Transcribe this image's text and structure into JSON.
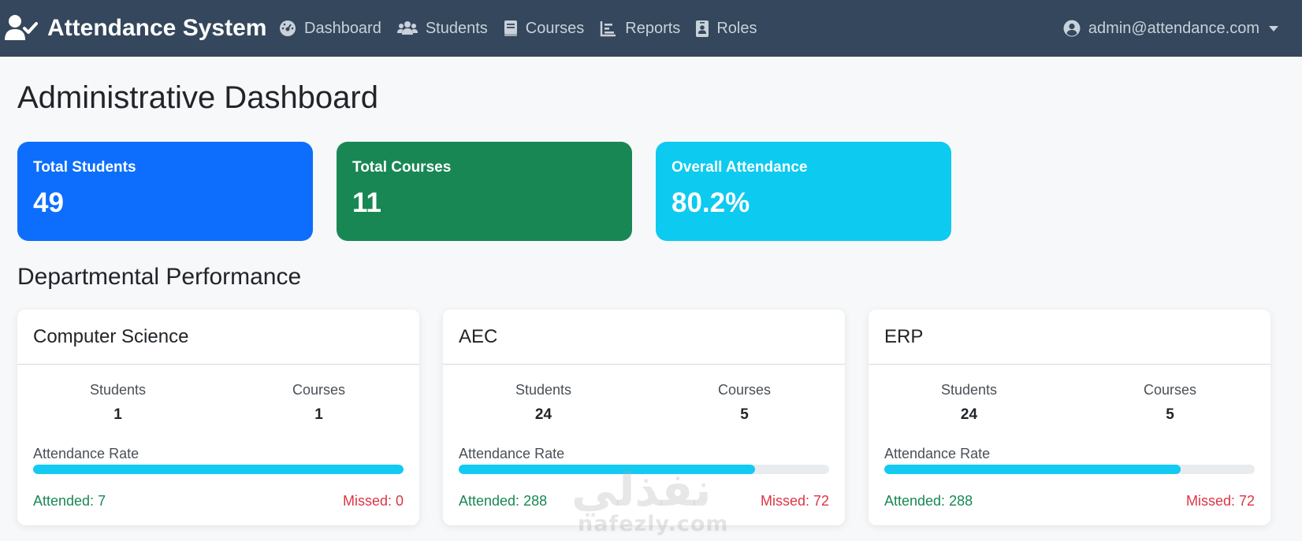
{
  "navbar": {
    "brand": "Attendance System",
    "links": [
      {
        "label": "Dashboard",
        "icon": "dashboard-icon"
      },
      {
        "label": "Students",
        "icon": "users-icon"
      },
      {
        "label": "Courses",
        "icon": "book-icon"
      },
      {
        "label": "Reports",
        "icon": "bar-chart-icon"
      },
      {
        "label": "Roles",
        "icon": "id-badge-icon"
      }
    ],
    "user": "admin@attendance.com"
  },
  "page_title": "Administrative Dashboard",
  "stats": [
    {
      "label": "Total Students",
      "value": "49",
      "color": "#0d6efd"
    },
    {
      "label": "Total Courses",
      "value": "11",
      "color": "#198754"
    },
    {
      "label": "Overall Attendance",
      "value": "80.2%",
      "color": "#0dcaf0"
    }
  ],
  "section_title": "Departmental Performance",
  "departments": [
    {
      "name": "Computer Science",
      "students_label": "Students",
      "students": "1",
      "courses_label": "Courses",
      "courses": "1",
      "rate_label": "Attendance Rate",
      "rate": 100,
      "attended": "Attended: 7",
      "missed": "Missed: 0"
    },
    {
      "name": "AEC",
      "students_label": "Students",
      "students": "24",
      "courses_label": "Courses",
      "courses": "5",
      "rate_label": "Attendance Rate",
      "rate": 80,
      "attended": "Attended: 288",
      "missed": "Missed: 72"
    },
    {
      "name": "ERP",
      "students_label": "Students",
      "students": "24",
      "courses_label": "Courses",
      "courses": "5",
      "rate_label": "Attendance Rate",
      "rate": 80,
      "attended": "Attended: 288",
      "missed": "Missed: 72"
    }
  ],
  "watermark": {
    "arabic": "نفذلي",
    "latin": "nafezly.com"
  }
}
